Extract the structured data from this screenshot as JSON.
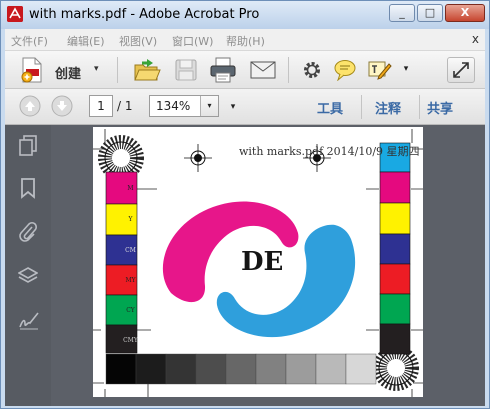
{
  "window": {
    "title": "with marks.pdf - Adobe Acrobat Pro",
    "minimize_glyph": "_",
    "maximize_glyph": "□",
    "close_glyph": "X"
  },
  "menus": [
    "文件(F)",
    "编辑(E)",
    "视图(V)",
    "窗口(W)",
    "帮助(H)"
  ],
  "menu_close_glyph": "x",
  "toolbar": {
    "create_label": "创建",
    "create_caret": "▾",
    "icons": [
      "create-pdf-icon",
      "open-folder-icon",
      "save-icon",
      "print-icon",
      "email-icon",
      "settings-icon",
      "comment-icon",
      "sign-icon",
      "expand-icon"
    ],
    "more_caret": "▾"
  },
  "navigation": {
    "current_page": "1",
    "total_pages": "/ 1",
    "zoom": "134%",
    "zoom_caret": "▾",
    "more_caret": "▾"
  },
  "panels": {
    "tools": "工具",
    "comment": "注释",
    "share": "共享"
  },
  "left_rail_icons": [
    "pages-icon",
    "bookmark-icon",
    "attachment-icon",
    "layers-icon",
    "signature-icon"
  ],
  "document": {
    "header_text": "with marks.pdf   2014/10/9 星期四",
    "logo_text": "DE",
    "left_patch_labels": [
      "",
      "M",
      "Y",
      "CM",
      "MY",
      "CY",
      "CMY"
    ],
    "colors": {
      "cyan": "#19a9e3",
      "magenta": "#e5097f",
      "yellow": "#fff200",
      "blue": "#2e3192",
      "red": "#ed1c24",
      "green": "#00a651",
      "black": "#231f20",
      "logo_magenta": "#e7168a",
      "logo_cyan": "#2f9fdc"
    }
  }
}
